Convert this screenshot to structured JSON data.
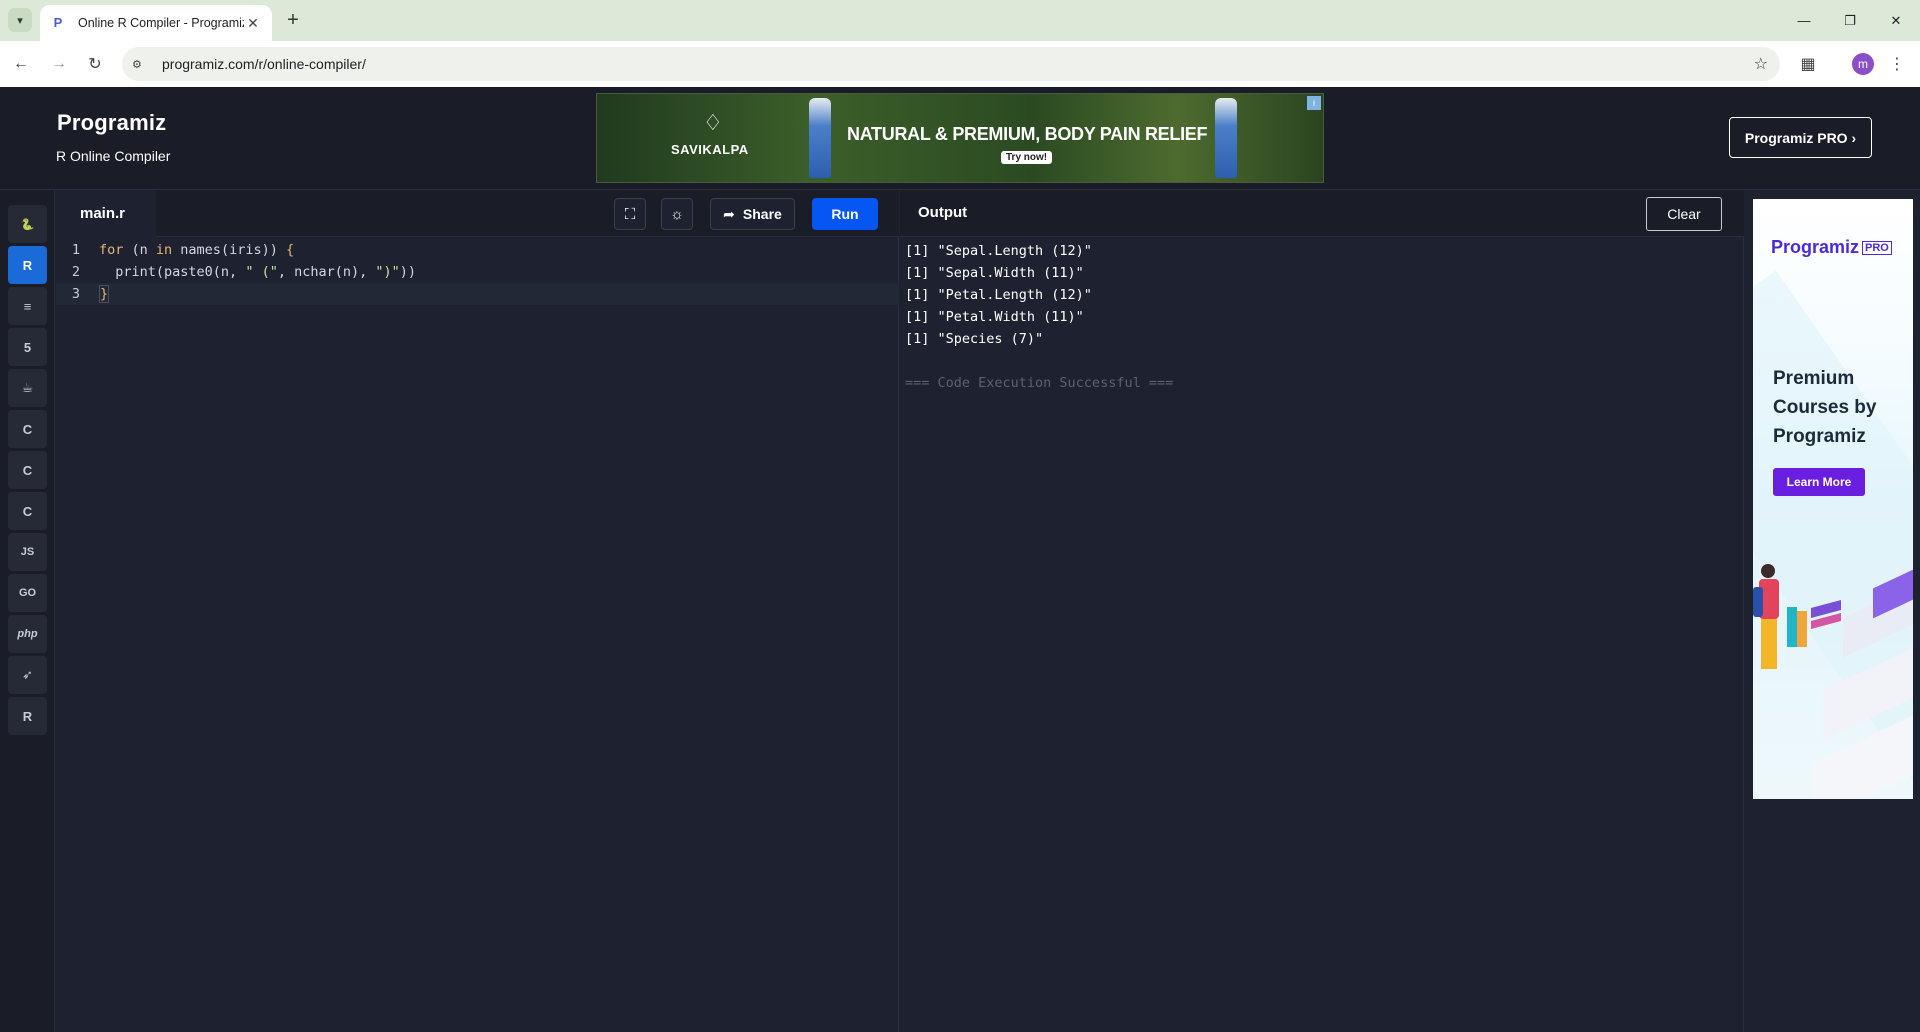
{
  "browser": {
    "tab_title": "Online R Compiler - Programiz",
    "tab_favicon": "P",
    "url": "programiz.com/r/online-compiler/",
    "profile_initial": "m"
  },
  "header": {
    "logo": "Programiz",
    "subtitle": "R Online Compiler",
    "pro_button": "Programiz PRO ›"
  },
  "banner_ad": {
    "brand": "SAVIKALPA",
    "headline": "NATURAL & PREMIUM, BODY PAIN RELIEF",
    "cta": "Try now!"
  },
  "languages": [
    {
      "name": "python-icon",
      "glyph": "🐍",
      "active": false
    },
    {
      "name": "r-icon",
      "glyph": "R",
      "active": true
    },
    {
      "name": "sql-icon",
      "glyph": "≡",
      "active": false
    },
    {
      "name": "html-icon",
      "glyph": "5",
      "active": false
    },
    {
      "name": "java-icon",
      "glyph": "☕",
      "active": false
    },
    {
      "name": "c-icon",
      "glyph": "C",
      "active": false
    },
    {
      "name": "cpp-icon",
      "glyph": "C",
      "active": false
    },
    {
      "name": "csharp-icon",
      "glyph": "C",
      "active": false
    },
    {
      "name": "javascript-icon",
      "glyph": "JS",
      "active": false
    },
    {
      "name": "go-icon",
      "glyph": "GO",
      "active": false
    },
    {
      "name": "php-icon",
      "glyph": "php",
      "active": false
    },
    {
      "name": "swift-icon",
      "glyph": "➶",
      "active": false
    },
    {
      "name": "rust-icon",
      "glyph": "R",
      "active": false
    }
  ],
  "editor": {
    "file_name": "main.r",
    "share_label": "Share",
    "run_label": "Run",
    "lines": [
      {
        "n": "1"
      },
      {
        "n": "2"
      },
      {
        "n": "3"
      }
    ]
  },
  "output": {
    "title": "Output",
    "clear_label": "Clear",
    "lines": [
      "[1] \"Sepal.Length (12)\"",
      "[1] \"Sepal.Width (11)\"",
      "[1] \"Petal.Length (12)\"",
      "[1] \"Petal.Width (11)\"",
      "[1] \"Species (7)\""
    ],
    "status": "=== Code Execution Successful ==="
  },
  "side_ad": {
    "logo": "Programiz",
    "logo_badge": "PRO",
    "heading": "Premium Courses by Programiz",
    "cta": "Learn More"
  },
  "colors": {
    "run_button": "#0556f3",
    "active_language": "#1a6bd8",
    "side_cta": "#6a1fe0"
  }
}
